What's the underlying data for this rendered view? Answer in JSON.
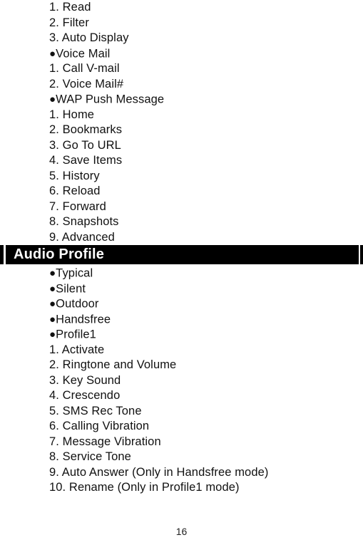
{
  "document": {
    "page_number": "16"
  },
  "sections": [
    {
      "id": "message-menu-continued",
      "items": [
        {
          "marker": "1.",
          "bullet": "",
          "label": "Read"
        },
        {
          "marker": "2.",
          "bullet": "",
          "label": "Filter"
        },
        {
          "marker": "3.",
          "bullet": "",
          "label": "Auto Display"
        },
        {
          "marker": "",
          "bullet": "●",
          "label": "Voice Mail"
        },
        {
          "marker": "1.",
          "bullet": "",
          "label": "Call V-mail"
        },
        {
          "marker": "2.",
          "bullet": "",
          "label": "Voice Mail#"
        },
        {
          "marker": "",
          "bullet": "●",
          "label": "WAP Push Message"
        },
        {
          "marker": "1.",
          "bullet": "",
          "label": "Home"
        },
        {
          "marker": "2.",
          "bullet": "",
          "label": "Bookmarks"
        },
        {
          "marker": "3.",
          "bullet": "",
          "label": "Go To URL"
        },
        {
          "marker": "4.",
          "bullet": "",
          "label": "Save Items"
        },
        {
          "marker": "5.",
          "bullet": "",
          "label": "History"
        },
        {
          "marker": "6.",
          "bullet": "",
          "label": "Reload"
        },
        {
          "marker": "7.",
          "bullet": "",
          "label": "Forward"
        },
        {
          "marker": "8.",
          "bullet": "",
          "label": "Snapshots"
        },
        {
          "marker": "9.",
          "bullet": "",
          "label": "Advanced"
        }
      ]
    }
  ],
  "banner": {
    "title": "Audio Profile",
    "background_color": "#000000",
    "text_color": "#ffffff"
  },
  "audio_profile": {
    "items": [
      {
        "marker": "",
        "bullet": "●",
        "label": "Typical"
      },
      {
        "marker": "",
        "bullet": "●",
        "label": "Silent"
      },
      {
        "marker": "",
        "bullet": "●",
        "label": "Outdoor"
      },
      {
        "marker": "",
        "bullet": "●",
        "label": "Handsfree"
      },
      {
        "marker": "",
        "bullet": "●",
        "label": "Profile1"
      },
      {
        "marker": "1.",
        "bullet": "",
        "label": "Activate"
      },
      {
        "marker": "2.",
        "bullet": "",
        "label": "Ringtone and Volume"
      },
      {
        "marker": "3.",
        "bullet": "",
        "label": "Key Sound"
      },
      {
        "marker": "4.",
        "bullet": "",
        "label": "Crescendo"
      },
      {
        "marker": "5.",
        "bullet": "",
        "label": "SMS Rec Tone"
      },
      {
        "marker": "6.",
        "bullet": "",
        "label": "Calling Vibration"
      },
      {
        "marker": "7.",
        "bullet": "",
        "label": "Message Vibration"
      },
      {
        "marker": "8.",
        "bullet": "",
        "label": "Service Tone"
      },
      {
        "marker": "9.",
        "bullet": "",
        "label": "Auto Answer (Only in Handsfree mode)"
      },
      {
        "marker": "10.",
        "bullet": "",
        "label": "Rename (Only in Profile1 mode)"
      }
    ]
  }
}
